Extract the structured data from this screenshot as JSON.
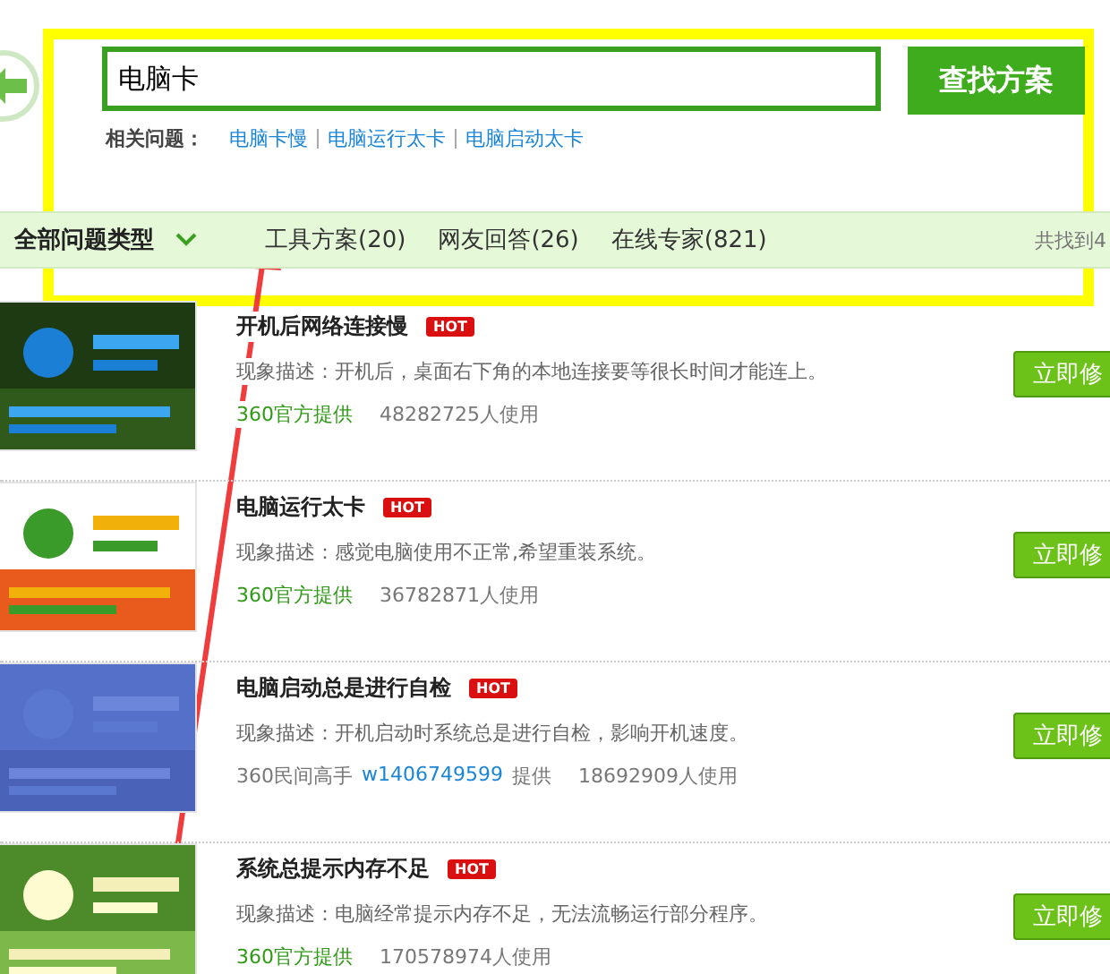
{
  "search": {
    "value": "电脑卡",
    "button": "查找方案"
  },
  "related": {
    "label": "相关问题：",
    "links": [
      "电脑卡慢",
      "电脑运行太卡",
      "电脑启动太卡"
    ]
  },
  "filter": {
    "category": "全部问题类型",
    "tabs": [
      {
        "label": "工具方案(20)"
      },
      {
        "label": "网友回答(26)"
      },
      {
        "label": "在线专家(821)"
      }
    ],
    "count": "共找到4"
  },
  "results": [
    {
      "title": "开机后网络连接慢",
      "badge": "HOT",
      "desc": "现象描述：开机后，桌面右下角的本地连接要等很长时间才能连上。",
      "source": {
        "kind": "official",
        "text": "360官方提供"
      },
      "uses": "48282725人使用",
      "action": "立即修"
    },
    {
      "title": "电脑运行太卡",
      "badge": "HOT",
      "desc": "现象描述：感觉电脑使用不正常,希望重装系统。",
      "source": {
        "kind": "official",
        "text": "360官方提供"
      },
      "uses": "36782871人使用",
      "action": "立即修"
    },
    {
      "title": "电脑启动总是进行自检",
      "badge": "HOT",
      "desc": "现象描述：开机启动时系统总是进行自检，影响开机速度。",
      "source": {
        "kind": "user",
        "text": "360民间高手",
        "user": "w1406749599",
        "suffix": "提供"
      },
      "uses": "18692909人使用",
      "action": "立即修"
    },
    {
      "title": "系统总提示内存不足",
      "badge": "HOT",
      "desc": "现象描述：电脑经常提示内存不足，无法流畅运行部分程序。",
      "source": {
        "kind": "official",
        "text": "360官方提供"
      },
      "uses": "170578974人使用",
      "action": "立即修"
    }
  ]
}
